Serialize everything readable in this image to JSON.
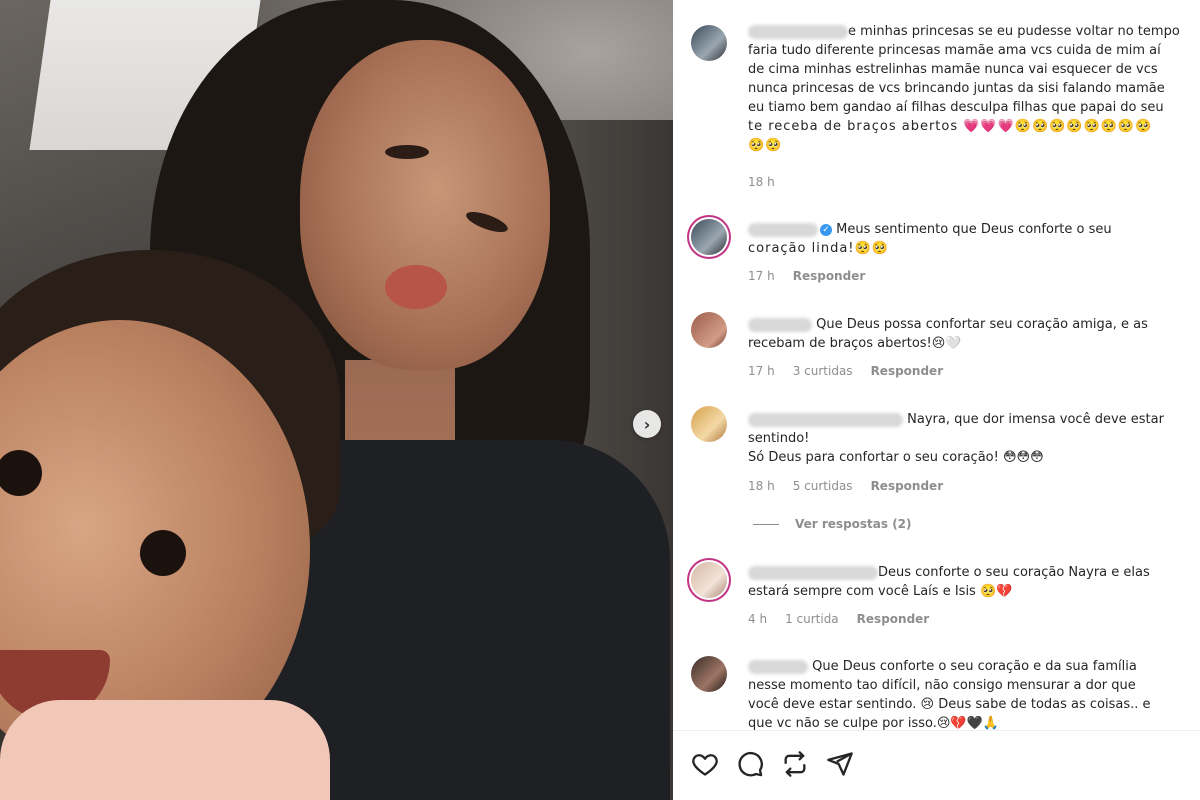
{
  "post": {
    "carousel_next_icon": "chevron-right-icon"
  },
  "comments": [
    {
      "text_lines": [
        "e minhas princesas se eu pudesse voltar no tempo",
        "faria tudo diferente princesas mamãe ama vcs cuida de mim aí",
        "de cima minhas estrelinhas mamãe nunca vai esquecer de vcs",
        "nunca princesas de vcs brincando juntas da sisi falando mamãe",
        "eu tiamo bem gandao aí filhas desculpa filhas que papai do seu",
        "te receba de braços abertos 💗💗💗🥺🥺🥺🥺🥺🥺🥺🥺",
        "🥺🥺"
      ],
      "time": "18 h"
    },
    {
      "text_lines": [
        "Meus sentimento que Deus conforte o seu",
        "coração linda!🥺🥺"
      ],
      "time": "17 h",
      "reply": "Responder"
    },
    {
      "text_lines": [
        "Que Deus possa confortar seu coração amiga, e as",
        "recebam de braços abertos!😢🤍"
      ],
      "time": "17 h",
      "likes": "3 curtidas",
      "reply": "Responder"
    },
    {
      "text_lines": [
        "Nayra, que dor imensa você deve estar",
        "sentindo!",
        "Só Deus para confortar o seu coração! 😳😳😳"
      ],
      "time": "18 h",
      "likes": "5 curtidas",
      "reply": "Responder",
      "view_replies": "Ver respostas (2)"
    },
    {
      "text_lines": [
        "Deus conforte o seu coração Nayra e elas",
        "estará sempre com você Laís e Isis 🥺💔"
      ],
      "time": "4 h",
      "likes": "1 curtida",
      "reply": "Responder"
    },
    {
      "text_lines": [
        "Que Deus conforte o seu coração e da sua família",
        "nesse momento tao difícil, não consigo mensurar a dor que",
        "você deve estar sentindo. 😢 Deus sabe de todas as coisas.. e",
        "que vc não se culpe por isso.😢💔🖤🙏"
      ]
    }
  ],
  "actions": {
    "like_icon": "heart-icon",
    "comment_icon": "comment-icon",
    "share_icon": "repost-icon",
    "send_icon": "send-icon"
  },
  "colors": {
    "text": "#262626",
    "meta": "#8e8e8e",
    "verified": "#3897f0",
    "story_ring": "#c13584"
  }
}
